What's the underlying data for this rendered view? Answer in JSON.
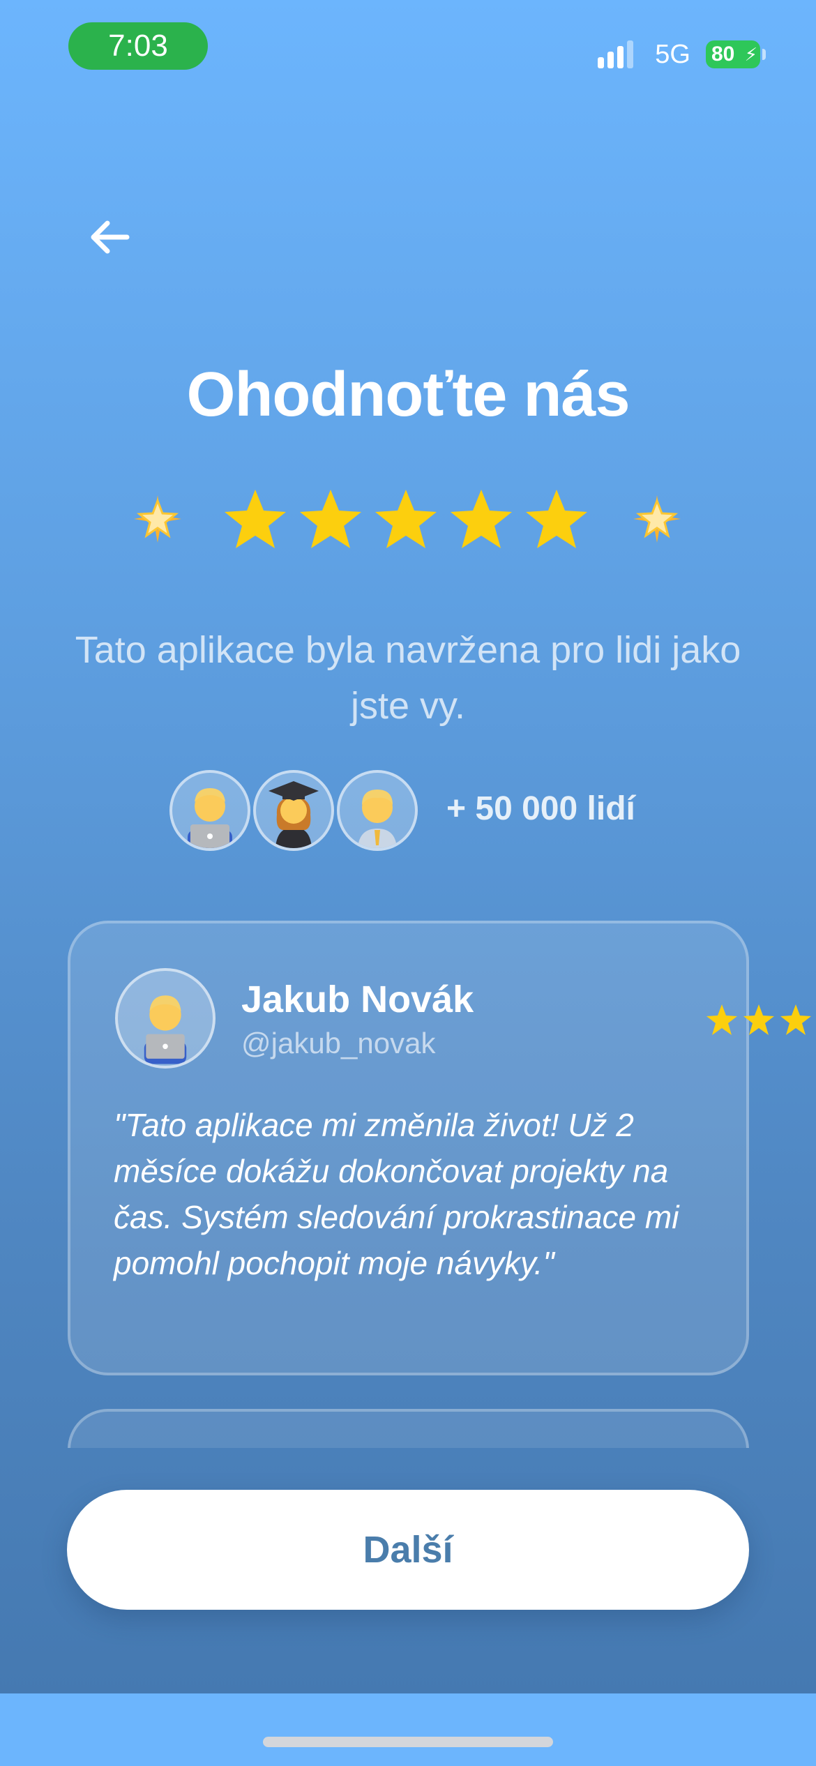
{
  "status_bar": {
    "time": "7:03",
    "network": "5G",
    "battery": "80"
  },
  "header": {
    "back_icon": "arrow-left-icon"
  },
  "page": {
    "title": "Ohodnoťte nás",
    "rating_stars": 5,
    "subtitle": "Tato aplikace byla navržena pro lidi jako jste vy.",
    "people_count": "+ 50 000 lidí",
    "avatars": [
      "man-technologist-icon",
      "woman-student-icon",
      "man-office-worker-icon"
    ]
  },
  "review": {
    "name": "Jakub Novák",
    "handle": "@jakub_novak",
    "text": "\"Tato aplikace mi změnila život! Už 2 měsíce dokážu dokončovat projekty na čas. Systém sledování prokrastinace mi pomohl pochopit moje návyky.\"",
    "avatar_icon": "man-technologist-icon"
  },
  "footer": {
    "next_label": "Další"
  },
  "colors": {
    "background_top": "#6cb5fd",
    "background_bottom": "#4579b1",
    "star": "#fccf0e",
    "time_pill": "#2bb24c",
    "battery": "#2ec759",
    "button_text": "#4a7dab"
  }
}
